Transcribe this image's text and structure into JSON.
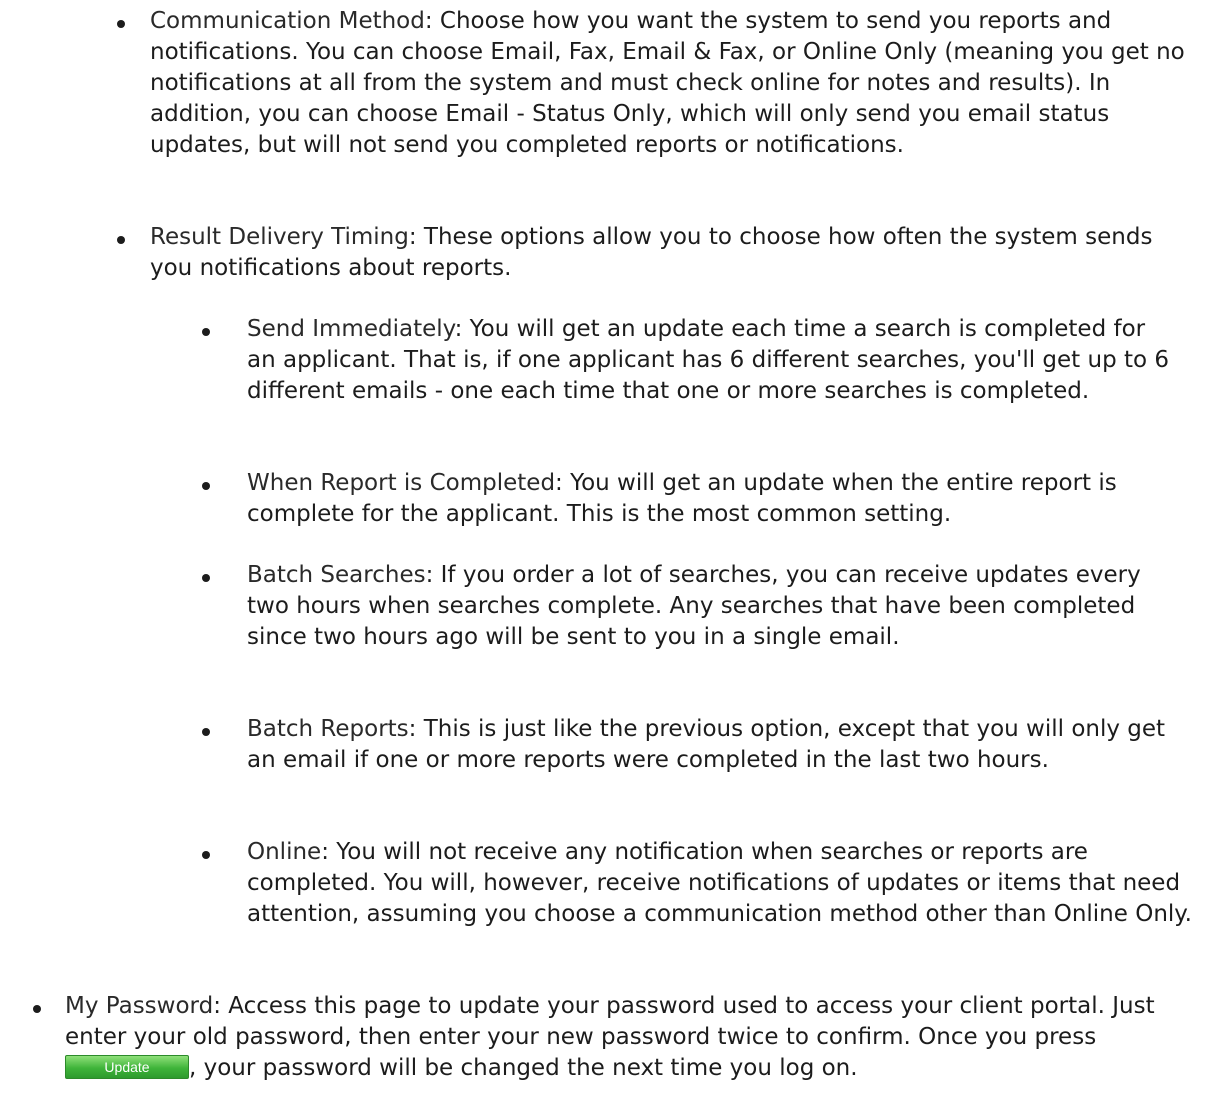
{
  "items": [
    {
      "term": "Communication Method",
      "text": ": Choose how you want the system to send you reports and notifications. You can choose Email, Fax, Email & Fax, or Online Only (meaning you get no notifications at all from the system and must check online for notes and results). In addition, you can choose Email - Status Only, which will only send you email status updates, but will not send you completed reports or notifications."
    },
    {
      "term": "Result Delivery Timing",
      "text": ": These options allow you to choose how often the system sends you notifications about reports."
    }
  ],
  "timing_options": [
    {
      "term": "Send Immediately",
      "text": ": You will get an update each time a search is completed for an applicant. That is, if one applicant has 6 different searches, you'll get up to 6 different emails - one each time that one or more searches is completed."
    },
    {
      "term": "When Report is Completed",
      "text": ": You will get an update when the entire report is complete for the applicant. This is the most common setting."
    },
    {
      "term": "Batch Searches",
      "text": ": If you order a lot of searches, you can receive updates every two hours when searches complete. Any searches that have been completed since two hours ago will be sent to you in a single email."
    },
    {
      "term": "Batch Reports",
      "text": ": This is just like the previous option, except that you will only get an email if one or more reports were completed in the last two hours."
    },
    {
      "term": "Online",
      "text": ": You will not receive any notification when searches or reports are completed. You will, however, receive notifications of updates or items that need attention, assuming you choose a communication method other than Online Only."
    }
  ],
  "password": {
    "term": "My Password",
    "text_before": ": Access this page to update your password used to access your client portal. Just enter your old password, then enter your new password twice to confirm. Once you press ",
    "button_label": "Update",
    "text_after": ", your password will be changed the next time you log on."
  }
}
